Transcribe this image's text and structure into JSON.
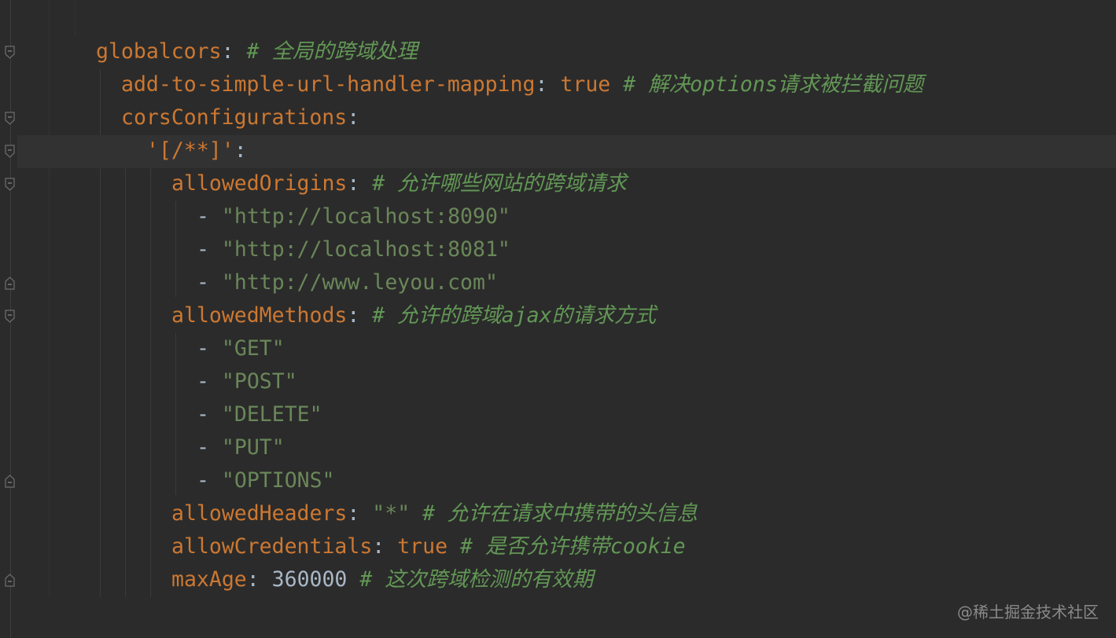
{
  "editor": {
    "theme": "darcula",
    "colors": {
      "background": "#2b2b2b",
      "key": "#cc7832",
      "string": "#6a8759",
      "comment": "#629755",
      "text": "#a9b7c6"
    },
    "lines": [
      {
        "key": "globalcors",
        "sep": ":",
        "value": "",
        "comment": " # 全局的跨域处理"
      },
      {
        "key": "add-to-simple-url-handler-mapping",
        "sep": ":",
        "value": " true",
        "comment": " # 解决options请求被拦截问题"
      },
      {
        "key": "corsConfigurations",
        "sep": ":",
        "value": "",
        "comment": ""
      },
      {
        "key": "'[/**]'",
        "sep": ":",
        "value": "",
        "comment": ""
      },
      {
        "key": "allowedOrigins",
        "sep": ":",
        "value": "",
        "comment": " # 允许哪些网站的跨域请求"
      },
      {
        "dash": "- ",
        "string": "\"http://localhost:8090\""
      },
      {
        "dash": "- ",
        "string": "\"http://localhost:8081\""
      },
      {
        "dash": "- ",
        "string": "\"http://www.leyou.com\""
      },
      {
        "key": "allowedMethods",
        "sep": ":",
        "value": "",
        "comment": " # 允许的跨域ajax的请求方式"
      },
      {
        "dash": "- ",
        "string": "\"GET\""
      },
      {
        "dash": "- ",
        "string": "\"POST\""
      },
      {
        "dash": "- ",
        "string": "\"DELETE\""
      },
      {
        "dash": "- ",
        "string": "\"PUT\""
      },
      {
        "dash": "- ",
        "string": "\"OPTIONS\""
      },
      {
        "key": "allowedHeaders",
        "sep": ":",
        "string": " \"*\"",
        "comment": " # 允许在请求中携带的头信息"
      },
      {
        "key": "allowCredentials",
        "sep": ":",
        "value": " true",
        "comment": " # 是否允许携带cookie"
      },
      {
        "key": "maxAge",
        "sep": ":",
        "number": " 360000",
        "comment": " # 这次跨域检测的有效期"
      }
    ]
  },
  "watermark": "@稀土掘金技术社区"
}
